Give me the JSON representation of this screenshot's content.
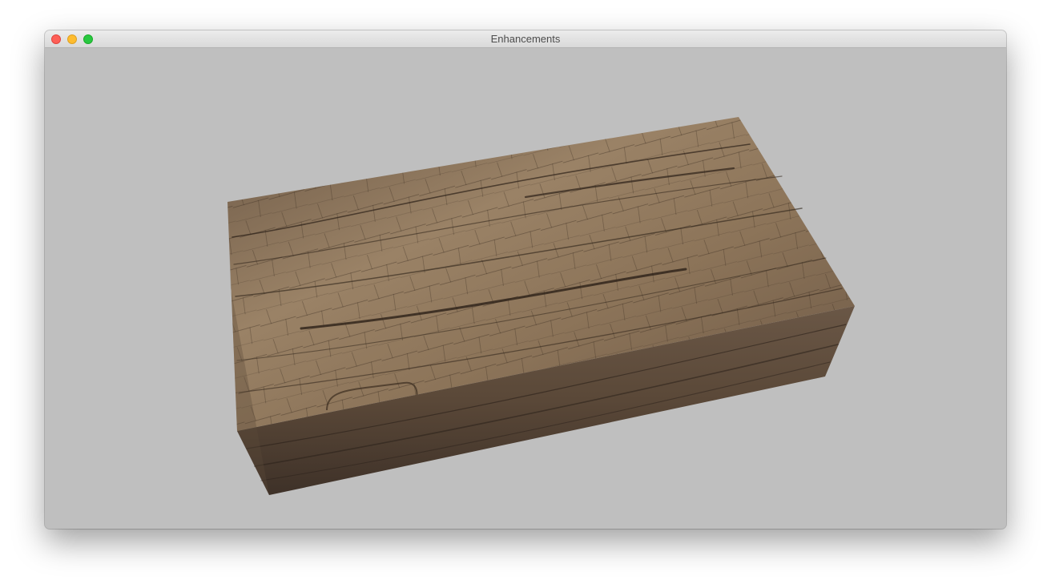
{
  "window": {
    "title": "Enhancements",
    "controls": {
      "close_color": "#fe5f57",
      "minimize_color": "#febc2e",
      "zoom_color": "#28c840"
    }
  },
  "scene": {
    "background_color": "#bfbfbf",
    "object": "textured-wood-box",
    "top_face_color": "#8a7258",
    "front_face_color": "#5a4838",
    "side_face_color": "#4e3f31"
  }
}
